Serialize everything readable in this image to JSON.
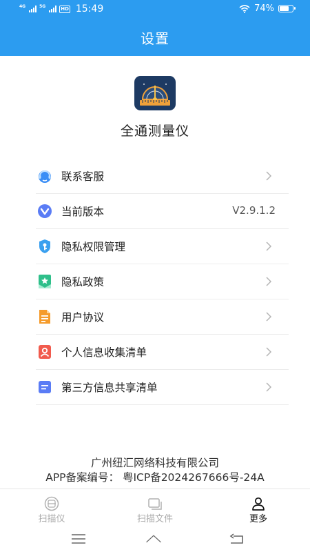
{
  "status": {
    "net1": "4G",
    "net2": "5G",
    "hd": "HD",
    "time": "15:49",
    "battery_pct": "74%",
    "battery_level": 0.74
  },
  "header": {
    "title": "设置"
  },
  "app": {
    "name": "全通测量仪",
    "logo_icon": "protractor-ruler-logo"
  },
  "menu": [
    {
      "label": "联系客服",
      "icon": "customer-service-icon",
      "chevron": true
    },
    {
      "label": "当前版本",
      "icon": "version-icon",
      "value": "V2.9.1.2"
    },
    {
      "label": "隐私权限管理",
      "icon": "privacy-shield-icon",
      "chevron": true
    },
    {
      "label": "隐私政策",
      "icon": "policy-bookmark-icon",
      "chevron": true
    },
    {
      "label": "用户协议",
      "icon": "agreement-document-icon",
      "chevron": true
    },
    {
      "label": "个人信息收集清单",
      "icon": "personal-info-icon",
      "chevron": true
    },
    {
      "label": "第三方信息共享清单",
      "icon": "third-party-share-icon",
      "chevron": true
    }
  ],
  "footer": {
    "company": "广州纽汇网络科技有限公司",
    "icp": "APP备案编号：  粤ICP备2024267666号-24A"
  },
  "tabs": [
    {
      "label": "扫描仪",
      "icon": "scanner-icon",
      "active": false
    },
    {
      "label": "扫描文件",
      "icon": "files-icon",
      "active": false
    },
    {
      "label": "更多",
      "icon": "person-icon",
      "active": true
    }
  ],
  "colors": {
    "header": "#2c9cf0",
    "customer_service": "#3a8ef6",
    "version": "#5a7cf5",
    "privacy": "#3aa0ef",
    "policy": "#2fbf8a",
    "agreement": "#f59b2b",
    "personal_info": "#f15b4e",
    "share": "#5a7cf5"
  }
}
